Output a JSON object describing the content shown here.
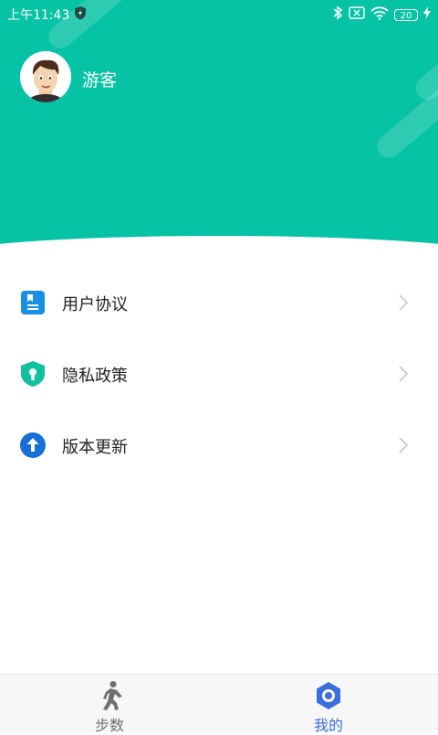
{
  "status_bar": {
    "time": "上午11:43",
    "battery": "20"
  },
  "profile": {
    "username": "游客"
  },
  "menu": [
    {
      "label": "用户协议",
      "icon": "document-icon"
    },
    {
      "label": "隐私政策",
      "icon": "privacy-shield-icon"
    },
    {
      "label": "版本更新",
      "icon": "update-arrow-icon"
    }
  ],
  "tabs": [
    {
      "label": "步数",
      "icon": "walking-icon",
      "active": false
    },
    {
      "label": "我的",
      "icon": "profile-hexagon-icon",
      "active": true
    }
  ],
  "colors": {
    "header": "#05c3a4",
    "active_tab": "#3a6fdd",
    "inactive_tab": "#6f6f6f"
  }
}
